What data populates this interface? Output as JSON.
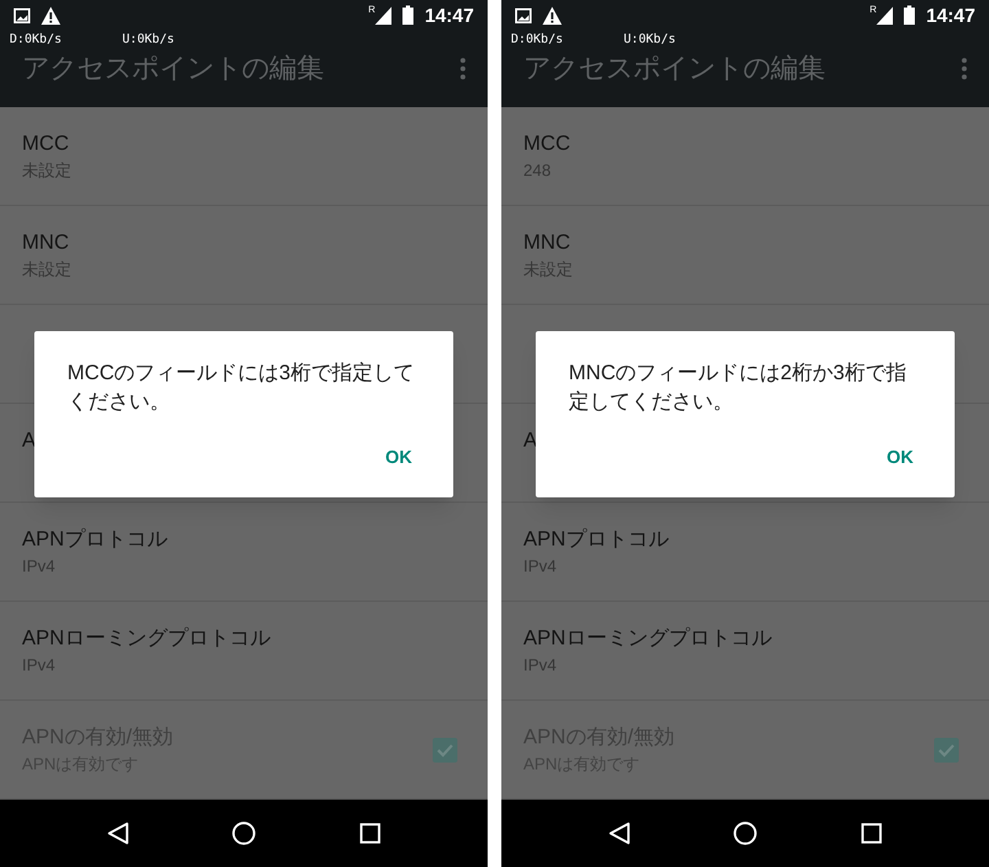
{
  "screens": [
    {
      "status_bar": {
        "roaming": "R",
        "time": "14:47",
        "download": "D:0Kb/s",
        "upload": "U:0Kb/s"
      },
      "toolbar": {
        "title": "アクセスポイントの編集"
      },
      "settings": [
        {
          "kind": "text",
          "title": "MCC",
          "summary": "未設定",
          "disabled": false
        },
        {
          "kind": "text",
          "title": "MNC",
          "summary": "未設定",
          "disabled": false
        },
        {
          "kind": "text"
        },
        {
          "kind": "text",
          "title": "A",
          "disabled": false
        },
        {
          "kind": "text",
          "title": "APNプロトコル",
          "summary": "IPv4",
          "disabled": false
        },
        {
          "kind": "text",
          "title": "APNローミングプロトコル",
          "summary": "IPv4",
          "disabled": false
        },
        {
          "kind": "checkbox",
          "title": "APNの有効/無効",
          "summary": "APNは有効です",
          "disabled": true,
          "checked": true
        }
      ],
      "dialog": {
        "message": "MCCのフィールドには3桁で指定してください。",
        "button": "OK"
      }
    },
    {
      "status_bar": {
        "roaming": "R",
        "time": "14:47",
        "download": "D:0Kb/s",
        "upload": "U:0Kb/s"
      },
      "toolbar": {
        "title": "アクセスポイントの編集"
      },
      "settings": [
        {
          "kind": "text",
          "title": "MCC",
          "summary": "248",
          "disabled": false
        },
        {
          "kind": "text",
          "title": "MNC",
          "summary": "未設定",
          "disabled": false
        },
        {
          "kind": "text"
        },
        {
          "kind": "text",
          "title": "A",
          "disabled": false
        },
        {
          "kind": "text",
          "title": "APNプロトコル",
          "summary": "IPv4",
          "disabled": false
        },
        {
          "kind": "text",
          "title": "APNローミングプロトコル",
          "summary": "IPv4",
          "disabled": false
        },
        {
          "kind": "checkbox",
          "title": "APNの有効/無効",
          "summary": "APNは有効です",
          "disabled": true,
          "checked": true
        }
      ],
      "dialog": {
        "message": "MNCのフィールドには2桁か3桁で指定してください。",
        "button": "OK"
      }
    }
  ]
}
